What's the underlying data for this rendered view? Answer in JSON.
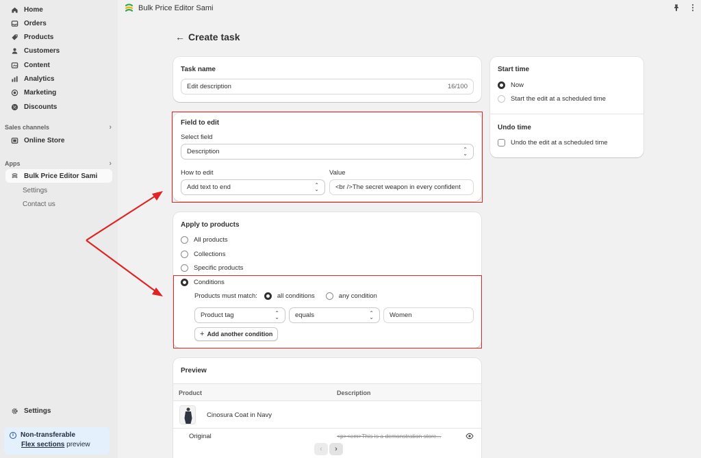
{
  "sidebar": {
    "items": [
      {
        "label": "Home",
        "icon": "home-icon"
      },
      {
        "label": "Orders",
        "icon": "inbox-icon"
      },
      {
        "label": "Products",
        "icon": "tag-icon"
      },
      {
        "label": "Customers",
        "icon": "person-icon"
      },
      {
        "label": "Content",
        "icon": "content-icon"
      },
      {
        "label": "Analytics",
        "icon": "chart-icon"
      },
      {
        "label": "Marketing",
        "icon": "target-icon"
      },
      {
        "label": "Discounts",
        "icon": "discount-icon"
      }
    ],
    "sales_channels_heading": "Sales channels",
    "online_store": "Online Store",
    "apps_heading": "Apps",
    "app_name": "Bulk Price Editor Sami",
    "app_settings": "Settings",
    "app_contact": "Contact us",
    "settings": "Settings",
    "notice": {
      "title": "Non-transferable",
      "link": "Flex sections",
      "link_suffix": " preview"
    }
  },
  "topbar": {
    "app_title": "Bulk Price Editor Sami"
  },
  "page": {
    "back": "←",
    "title": "Create task"
  },
  "task_name": {
    "title": "Task name",
    "value": "Edit description",
    "counter": "16/100"
  },
  "field_to_edit": {
    "title": "Field to edit",
    "select_label": "Select field",
    "select_value": "Description",
    "how_label": "How to edit",
    "how_value": "Add text to end",
    "value_label": "Value",
    "value_value": "<br />The secret weapon in every confident"
  },
  "apply": {
    "title": "Apply to products",
    "options": [
      "All products",
      "Collections",
      "Specific products",
      "Conditions"
    ],
    "selected": "Conditions",
    "match_label": "Products must match:",
    "match_all": "all conditions",
    "match_any": "any condition",
    "condition": {
      "field": "Product tag",
      "operator": "equals",
      "value": "Women"
    },
    "add_condition": "Add another condition"
  },
  "preview": {
    "title": "Preview",
    "col_product": "Product",
    "col_description": "Description",
    "product_name": "Cinosura Coat in Navy",
    "row_original": "Original",
    "original_desc": "<p><em>This is a demonstration store..."
  },
  "start_time": {
    "title": "Start time",
    "now": "Now",
    "scheduled": "Start the edit at a scheduled time"
  },
  "undo_time": {
    "title": "Undo time",
    "checkbox": "Undo the edit at a scheduled time"
  },
  "colors": {
    "highlight": "#e02424",
    "accent": "#303030",
    "notice_bg": "#e5f0fd"
  }
}
